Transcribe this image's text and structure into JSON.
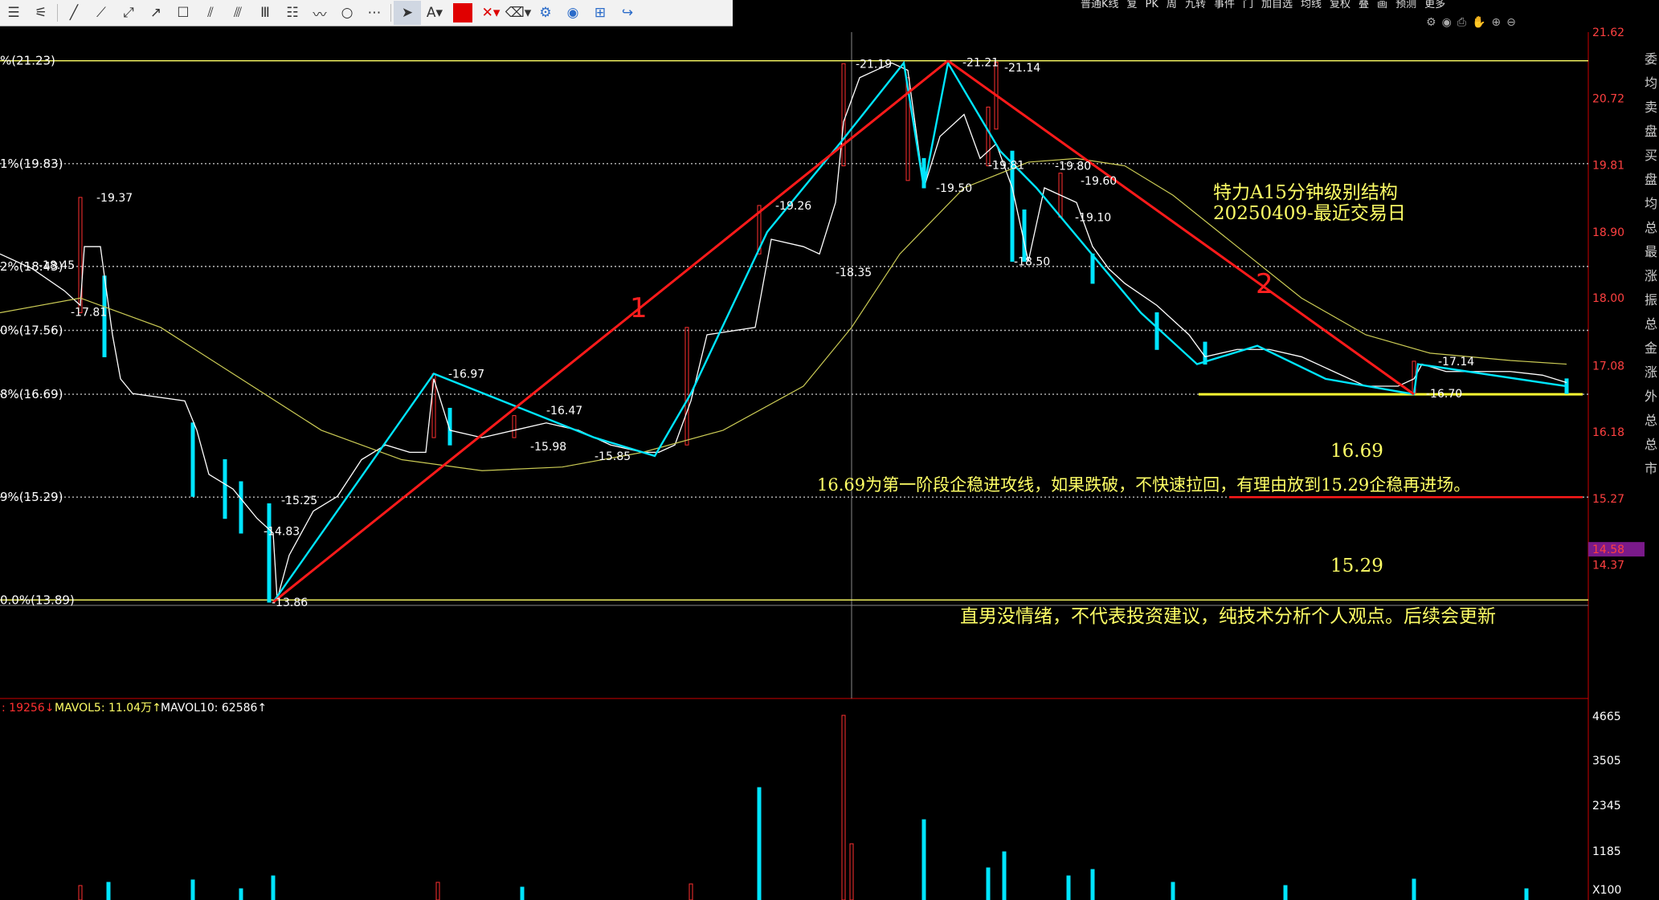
{
  "toolbar": {
    "tools": [
      "≡",
      "⊡",
      "╱",
      "╱",
      "╱",
      "↗",
      "☐",
      "⫽",
      "⫻",
      "Ⅲ",
      "☰",
      "⌇",
      "○",
      "⋯",
      "pointer",
      "A",
      "color",
      "✕",
      "erase",
      "⚙",
      "👁",
      "⊞",
      "↪"
    ]
  },
  "topbar": {
    "items": [
      "普通K线",
      "复",
      "PK",
      "周",
      "九转",
      "事件",
      "门",
      "加自选",
      "均线",
      "复权",
      "叠",
      "画",
      "预测",
      "更多"
    ]
  },
  "colors": {
    "background": "#000000",
    "yellow": "#ffff66",
    "cyan": "#00e5ff",
    "red": "#ff1a1a",
    "price_line": "#ffffff",
    "ma_line": "#cccc55"
  },
  "price_axis": [
    "21.62",
    "20.72",
    "19.81",
    "18.90",
    "18.00",
    "17.08",
    "16.18",
    "15.27",
    "14.58",
    "14.37"
  ],
  "price_axis_current": "14.58",
  "fib_levels": [
    {
      "label": "%(21.23)",
      "price": 21.23
    },
    {
      "label": "1%(19.83)",
      "price": 19.83
    },
    {
      "label": "2%(18.43)",
      "price": 18.43
    },
    {
      "label": "0%(17.56)",
      "price": 17.56
    },
    {
      "label": "8%(16.69)",
      "price": 16.69
    },
    {
      "label": "9%(15.29)",
      "price": 15.29
    },
    {
      "label": "0.0%(13.89)",
      "price": 13.89
    }
  ],
  "price_annotations": [
    "19.37",
    "18.45",
    "17.81",
    "16.97",
    "16.47",
    "15.98",
    "15.85",
    "15.25",
    "14.83",
    "13.86",
    "19.26",
    "18.35",
    "21.19",
    "21.21",
    "21.14",
    "19.50",
    "19.81",
    "19.80",
    "19.60",
    "19.10",
    "18.50",
    "17.14",
    "16.70"
  ],
  "wave_labels": {
    "one": "1",
    "two": "2"
  },
  "notes": {
    "title": "特力A15分钟级别结构",
    "date": "20250409-最近交易日",
    "level1": "16.69",
    "explanation": "16.69为第一阶段企稳进攻线，如果跌破，不快速拉回，有理由放到15.29企稳再进场。",
    "level2": "15.29",
    "disclaimer": "直男没情绪，不代表投资建议，纯技术分析个人观点。后续会更新"
  },
  "volume": {
    "legend_vol": ": 19256↓",
    "legend_ma5": "MAVOL5: 11.04万↑",
    "legend_ma10": "MAVOL10: 62586↑",
    "axis": [
      "4665",
      "3505",
      "2345",
      "1185",
      "X100"
    ]
  },
  "sidebar": [
    "委",
    "均",
    "卖",
    "盘",
    "买",
    "盘",
    "均",
    "总",
    "最",
    "涨",
    "振",
    "总",
    "金",
    "涨",
    "外",
    "总",
    "总",
    "市"
  ]
}
